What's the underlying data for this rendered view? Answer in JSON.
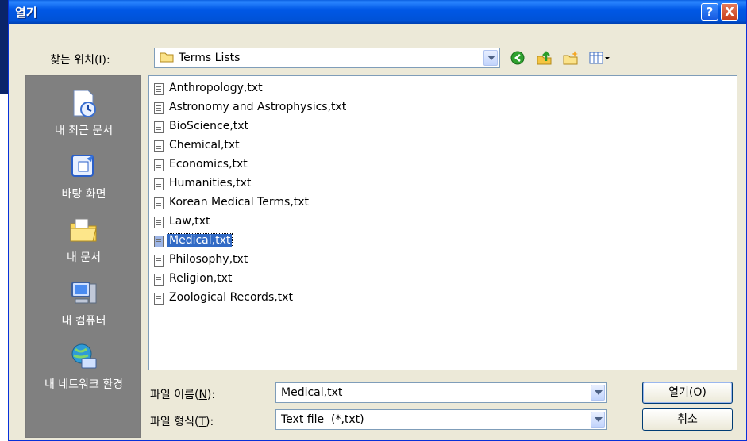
{
  "window": {
    "title": "열기",
    "help_label": "?",
    "close_label": "X"
  },
  "lookin": {
    "label": "찾는 위치(I):",
    "value": "Terms Lists"
  },
  "toolbar": {
    "icons": [
      "back-icon",
      "up-folder-icon",
      "new-folder-icon",
      "view-menu-icon"
    ]
  },
  "places": [
    {
      "label": "내 최근 문서",
      "icon": "recent-documents-icon"
    },
    {
      "label": "바탕 화면",
      "icon": "desktop-icon"
    },
    {
      "label": "내 문서",
      "icon": "my-documents-icon"
    },
    {
      "label": "내 컴퓨터",
      "icon": "my-computer-icon"
    },
    {
      "label": "내 네트워크 환경",
      "icon": "network-places-icon"
    }
  ],
  "files": [
    {
      "name": "Anthropology,txt",
      "selected": false
    },
    {
      "name": "Astronomy and Astrophysics,txt",
      "selected": false
    },
    {
      "name": "BioScience,txt",
      "selected": false
    },
    {
      "name": "Chemical,txt",
      "selected": false
    },
    {
      "name": "Economics,txt",
      "selected": false
    },
    {
      "name": "Humanities,txt",
      "selected": false
    },
    {
      "name": "Korean Medical Terms,txt",
      "selected": false
    },
    {
      "name": "Law,txt",
      "selected": false
    },
    {
      "name": "Medical,txt",
      "selected": true
    },
    {
      "name": "Philosophy,txt",
      "selected": false
    },
    {
      "name": "Religion,txt",
      "selected": false
    },
    {
      "name": "Zoological Records,txt",
      "selected": false
    }
  ],
  "filename": {
    "label_pre": "파일 이름(",
    "label_key": "N",
    "label_post": "):",
    "value": "Medical,txt"
  },
  "filetype": {
    "label_pre": "파일 형식(",
    "label_key": "T",
    "label_post": "):",
    "value": "Text file  (*,txt)"
  },
  "buttons": {
    "open_pre": "열기(",
    "open_key": "O",
    "open_post": ")",
    "cancel": "취소"
  },
  "colors": {
    "titlebar": "#0058e6",
    "selection": "#316ac5",
    "places_bar": "#808080",
    "dialog_bg": "#ece9d8"
  }
}
